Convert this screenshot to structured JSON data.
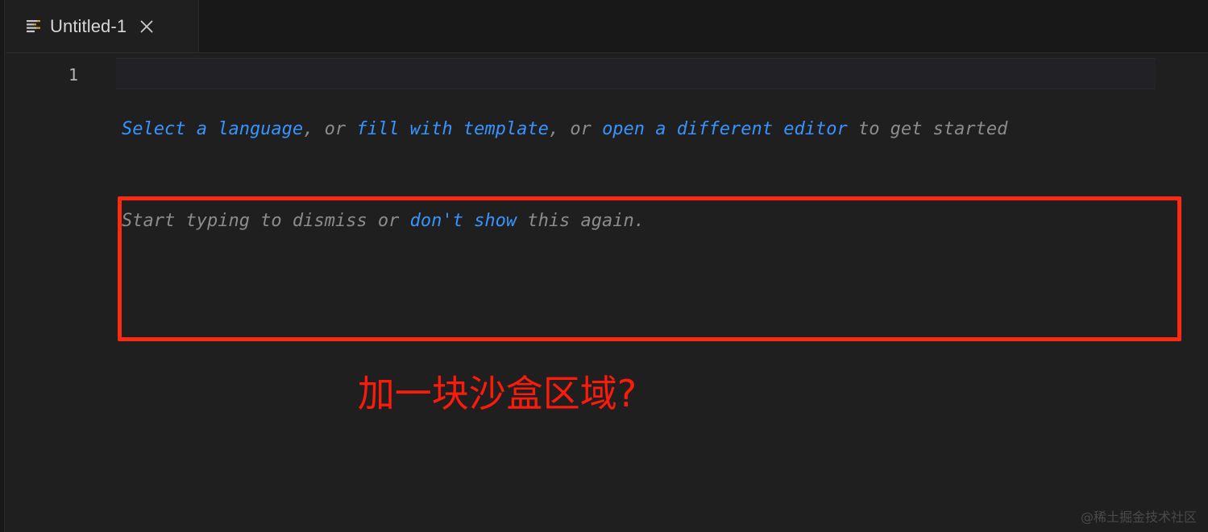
{
  "window": {
    "background_color": "#1f1f1f",
    "accent_red": "#fa2a13",
    "link_color": "#3794ff"
  },
  "tabbar": {
    "background_color": "#181818",
    "tabs": [
      {
        "label": "Untitled-1",
        "icon": "plain-text-file-icon",
        "active": true,
        "close_icon": "close-icon"
      }
    ]
  },
  "editor": {
    "line_numbers": [
      "1"
    ],
    "placeholder": {
      "line1": [
        {
          "text": "Select a language",
          "link": true
        },
        {
          "text": ", or ",
          "link": false
        },
        {
          "text": "fill with template",
          "link": true
        },
        {
          "text": ", or ",
          "link": false
        },
        {
          "text": "open a different editor",
          "link": true
        },
        {
          "text": " to get started",
          "link": false
        }
      ],
      "line2": [
        {
          "text": "Start typing to dismiss or ",
          "link": false
        },
        {
          "text": "don't show",
          "link": true
        },
        {
          "text": " this again.",
          "link": false
        }
      ]
    }
  },
  "annotation": {
    "box_color": "#fa2a13",
    "caption": "加一块沙盒区域?",
    "caption_color": "#fa1b0d"
  },
  "watermark": {
    "text": "@稀土掘金技术社区"
  }
}
